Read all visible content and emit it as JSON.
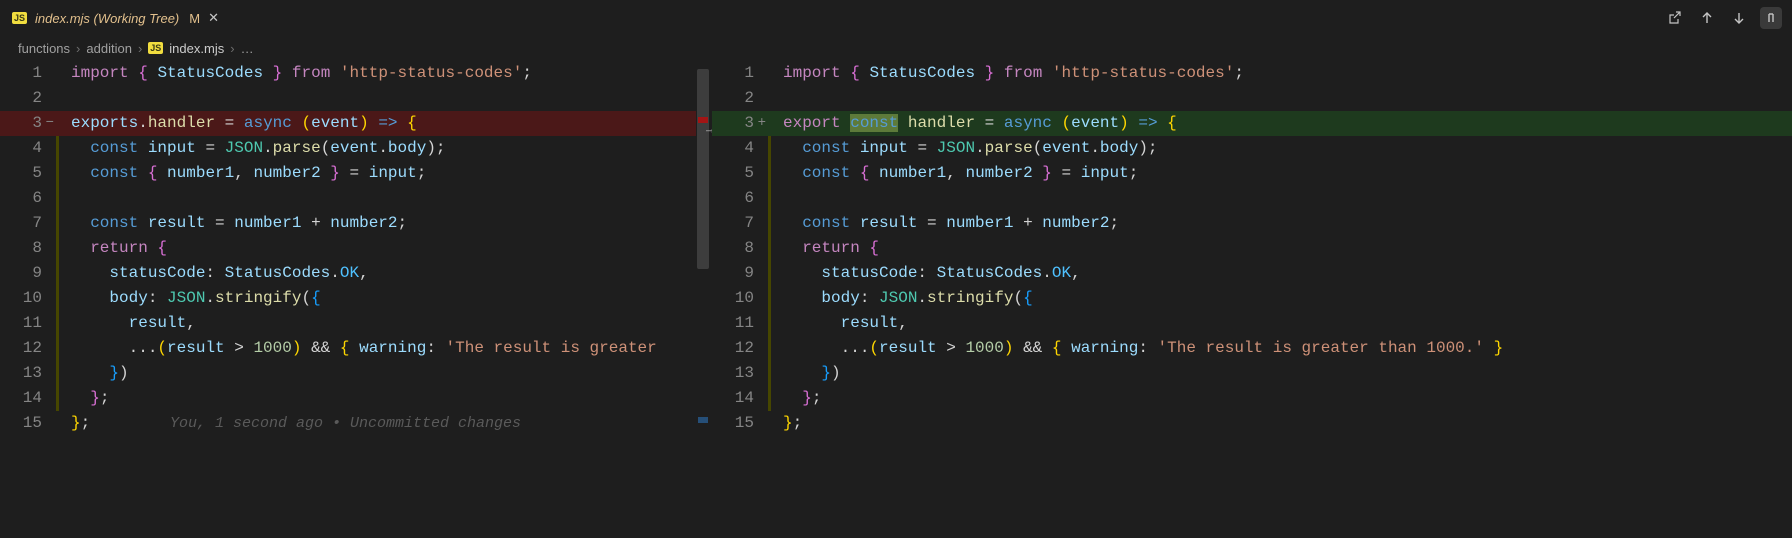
{
  "tab": {
    "icon_label": "JS",
    "title": "index.mjs (Working Tree)",
    "modified_badge": "M",
    "close_glyph": "✕"
  },
  "top_actions": {
    "names": [
      "open-file-icon",
      "prev-change-icon",
      "next-change-icon",
      "whitespace-icon"
    ]
  },
  "breadcrumbs": {
    "sep": "›",
    "parts": [
      "functions",
      "addition"
    ],
    "file_icon_label": "JS",
    "file": "index.mjs",
    "tail": "…"
  },
  "diff": {
    "arrow_glyph": "→"
  },
  "blame": {
    "text": "You, 1 second ago • Uncommitted changes"
  },
  "left": {
    "lines": [
      {
        "n": "1",
        "g": false,
        "m": "",
        "t": [
          [
            "kw",
            "import"
          ],
          [
            "pun",
            " "
          ],
          [
            "brc",
            "{"
          ],
          [
            "pun",
            " "
          ],
          [
            "var",
            "StatusCodes"
          ],
          [
            "pun",
            " "
          ],
          [
            "brc",
            "}"
          ],
          [
            "pun",
            " "
          ],
          [
            "kw",
            "from"
          ],
          [
            "pun",
            " "
          ],
          [
            "str",
            "'http-status-codes'"
          ],
          [
            "pun",
            ";"
          ]
        ]
      },
      {
        "n": "2",
        "g": false,
        "m": "",
        "t": []
      },
      {
        "n": "3",
        "g": false,
        "m": "−",
        "removed": true,
        "t": [
          [
            "var",
            "exports"
          ],
          [
            "pun",
            "."
          ],
          [
            "fn",
            "handler"
          ],
          [
            "pun",
            " = "
          ],
          [
            "kw2",
            "async"
          ],
          [
            "pun",
            " "
          ],
          [
            "brc3",
            "("
          ],
          [
            "var",
            "event"
          ],
          [
            "brc3",
            ")"
          ],
          [
            "pun",
            " "
          ],
          [
            "kw2",
            "=>"
          ],
          [
            "pun",
            " "
          ],
          [
            "brc3",
            "{"
          ]
        ]
      },
      {
        "n": "4",
        "g": true,
        "m": "",
        "t": [
          [
            "pun",
            "  "
          ],
          [
            "kw2",
            "const"
          ],
          [
            "pun",
            " "
          ],
          [
            "var",
            "input"
          ],
          [
            "pun",
            " = "
          ],
          [
            "cls",
            "JSON"
          ],
          [
            "pun",
            "."
          ],
          [
            "fn",
            "parse"
          ],
          [
            "pun",
            "("
          ],
          [
            "var",
            "event"
          ],
          [
            "pun",
            "."
          ],
          [
            "prop",
            "body"
          ],
          [
            "pun",
            ");"
          ]
        ]
      },
      {
        "n": "5",
        "g": true,
        "m": "",
        "t": [
          [
            "pun",
            "  "
          ],
          [
            "kw2",
            "const"
          ],
          [
            "pun",
            " "
          ],
          [
            "brc",
            "{"
          ],
          [
            "pun",
            " "
          ],
          [
            "var",
            "number1"
          ],
          [
            "pun",
            ", "
          ],
          [
            "var",
            "number2"
          ],
          [
            "pun",
            " "
          ],
          [
            "brc",
            "}"
          ],
          [
            "pun",
            " = "
          ],
          [
            "var",
            "input"
          ],
          [
            "pun",
            ";"
          ]
        ]
      },
      {
        "n": "6",
        "g": true,
        "m": "",
        "t": []
      },
      {
        "n": "7",
        "g": true,
        "m": "",
        "t": [
          [
            "pun",
            "  "
          ],
          [
            "kw2",
            "const"
          ],
          [
            "pun",
            " "
          ],
          [
            "var",
            "result"
          ],
          [
            "pun",
            " = "
          ],
          [
            "var",
            "number1"
          ],
          [
            "pun",
            " + "
          ],
          [
            "var",
            "number2"
          ],
          [
            "pun",
            ";"
          ]
        ]
      },
      {
        "n": "8",
        "g": true,
        "m": "",
        "t": [
          [
            "pun",
            "  "
          ],
          [
            "kw",
            "return"
          ],
          [
            "pun",
            " "
          ],
          [
            "brc",
            "{"
          ]
        ]
      },
      {
        "n": "9",
        "g": true,
        "m": "",
        "t": [
          [
            "pun",
            "    "
          ],
          [
            "prop",
            "statusCode"
          ],
          [
            "pun",
            ": "
          ],
          [
            "var",
            "StatusCodes"
          ],
          [
            "pun",
            "."
          ],
          [
            "cst",
            "OK"
          ],
          [
            "pun",
            ","
          ]
        ]
      },
      {
        "n": "10",
        "g": true,
        "m": "",
        "t": [
          [
            "pun",
            "    "
          ],
          [
            "prop",
            "body"
          ],
          [
            "pun",
            ": "
          ],
          [
            "cls",
            "JSON"
          ],
          [
            "pun",
            "."
          ],
          [
            "fn",
            "stringify"
          ],
          [
            "pun",
            "("
          ],
          [
            "brc2",
            "{"
          ]
        ]
      },
      {
        "n": "11",
        "g": true,
        "m": "",
        "t": [
          [
            "pun",
            "      "
          ],
          [
            "var",
            "result"
          ],
          [
            "pun",
            ","
          ]
        ]
      },
      {
        "n": "12",
        "g": true,
        "m": "",
        "t": [
          [
            "pun",
            "      ..."
          ],
          [
            "brc3",
            "("
          ],
          [
            "var",
            "result"
          ],
          [
            "pun",
            " > "
          ],
          [
            "num",
            "1000"
          ],
          [
            "brc3",
            ")"
          ],
          [
            "pun",
            " && "
          ],
          [
            "brc3",
            "{"
          ],
          [
            "pun",
            " "
          ],
          [
            "prop",
            "warning"
          ],
          [
            "pun",
            ": "
          ],
          [
            "str",
            "'The result is greater"
          ]
        ]
      },
      {
        "n": "13",
        "g": true,
        "m": "",
        "t": [
          [
            "pun",
            "    "
          ],
          [
            "brc2",
            "}"
          ],
          [
            "pun",
            ")"
          ]
        ]
      },
      {
        "n": "14",
        "g": true,
        "m": "",
        "t": [
          [
            "pun",
            "  "
          ],
          [
            "brc",
            "}"
          ],
          [
            "pun",
            ";"
          ]
        ]
      },
      {
        "n": "15",
        "g": false,
        "m": "",
        "blame": true,
        "t": [
          [
            "brc3",
            "}"
          ],
          [
            "pun",
            ";"
          ]
        ]
      }
    ]
  },
  "right": {
    "lines": [
      {
        "n": "1",
        "g": false,
        "m": "",
        "t": [
          [
            "kw",
            "import"
          ],
          [
            "pun",
            " "
          ],
          [
            "brc",
            "{"
          ],
          [
            "pun",
            " "
          ],
          [
            "var",
            "StatusCodes"
          ],
          [
            "pun",
            " "
          ],
          [
            "brc",
            "}"
          ],
          [
            "pun",
            " "
          ],
          [
            "kw",
            "from"
          ],
          [
            "pun",
            " "
          ],
          [
            "str",
            "'http-status-codes'"
          ],
          [
            "pun",
            ";"
          ]
        ]
      },
      {
        "n": "2",
        "g": false,
        "m": "",
        "t": []
      },
      {
        "n": "3",
        "g": false,
        "m": "+",
        "added": true,
        "t": [
          [
            "kw",
            "export"
          ],
          [
            "pun",
            " "
          ],
          [
            "kw2 h-ins",
            "const"
          ],
          [
            "pun",
            " "
          ],
          [
            "fn",
            "handler"
          ],
          [
            "pun",
            " = "
          ],
          [
            "kw2",
            "async"
          ],
          [
            "pun",
            " "
          ],
          [
            "brc3",
            "("
          ],
          [
            "var",
            "event"
          ],
          [
            "brc3",
            ")"
          ],
          [
            "pun",
            " "
          ],
          [
            "kw2",
            "=>"
          ],
          [
            "pun",
            " "
          ],
          [
            "brc3",
            "{"
          ]
        ]
      },
      {
        "n": "4",
        "g": true,
        "m": "",
        "t": [
          [
            "pun",
            "  "
          ],
          [
            "kw2",
            "const"
          ],
          [
            "pun",
            " "
          ],
          [
            "var",
            "input"
          ],
          [
            "pun",
            " = "
          ],
          [
            "cls",
            "JSON"
          ],
          [
            "pun",
            "."
          ],
          [
            "fn",
            "parse"
          ],
          [
            "pun",
            "("
          ],
          [
            "var",
            "event"
          ],
          [
            "pun",
            "."
          ],
          [
            "prop",
            "body"
          ],
          [
            "pun",
            ");"
          ]
        ]
      },
      {
        "n": "5",
        "g": true,
        "m": "",
        "t": [
          [
            "pun",
            "  "
          ],
          [
            "kw2",
            "const"
          ],
          [
            "pun",
            " "
          ],
          [
            "brc",
            "{"
          ],
          [
            "pun",
            " "
          ],
          [
            "var",
            "number1"
          ],
          [
            "pun",
            ", "
          ],
          [
            "var",
            "number2"
          ],
          [
            "pun",
            " "
          ],
          [
            "brc",
            "}"
          ],
          [
            "pun",
            " = "
          ],
          [
            "var",
            "input"
          ],
          [
            "pun",
            ";"
          ]
        ]
      },
      {
        "n": "6",
        "g": true,
        "m": "",
        "t": []
      },
      {
        "n": "7",
        "g": true,
        "m": "",
        "t": [
          [
            "pun",
            "  "
          ],
          [
            "kw2",
            "const"
          ],
          [
            "pun",
            " "
          ],
          [
            "var",
            "result"
          ],
          [
            "pun",
            " = "
          ],
          [
            "var",
            "number1"
          ],
          [
            "pun",
            " + "
          ],
          [
            "var",
            "number2"
          ],
          [
            "pun",
            ";"
          ]
        ]
      },
      {
        "n": "8",
        "g": true,
        "m": "",
        "t": [
          [
            "pun",
            "  "
          ],
          [
            "kw",
            "return"
          ],
          [
            "pun",
            " "
          ],
          [
            "brc",
            "{"
          ]
        ]
      },
      {
        "n": "9",
        "g": true,
        "m": "",
        "t": [
          [
            "pun",
            "    "
          ],
          [
            "prop",
            "statusCode"
          ],
          [
            "pun",
            ": "
          ],
          [
            "var",
            "StatusCodes"
          ],
          [
            "pun",
            "."
          ],
          [
            "cst",
            "OK"
          ],
          [
            "pun",
            ","
          ]
        ]
      },
      {
        "n": "10",
        "g": true,
        "m": "",
        "t": [
          [
            "pun",
            "    "
          ],
          [
            "prop",
            "body"
          ],
          [
            "pun",
            ": "
          ],
          [
            "cls",
            "JSON"
          ],
          [
            "pun",
            "."
          ],
          [
            "fn",
            "stringify"
          ],
          [
            "pun",
            "("
          ],
          [
            "brc2",
            "{"
          ]
        ]
      },
      {
        "n": "11",
        "g": true,
        "m": "",
        "t": [
          [
            "pun",
            "      "
          ],
          [
            "var",
            "result"
          ],
          [
            "pun",
            ","
          ]
        ]
      },
      {
        "n": "12",
        "g": true,
        "m": "",
        "t": [
          [
            "pun",
            "      ..."
          ],
          [
            "brc3",
            "("
          ],
          [
            "var",
            "result"
          ],
          [
            "pun",
            " > "
          ],
          [
            "num",
            "1000"
          ],
          [
            "brc3",
            ")"
          ],
          [
            "pun",
            " && "
          ],
          [
            "brc3",
            "{"
          ],
          [
            "pun",
            " "
          ],
          [
            "prop",
            "warning"
          ],
          [
            "pun",
            ": "
          ],
          [
            "str",
            "'The result is greater than 1000.'"
          ],
          [
            "pun",
            " "
          ],
          [
            "brc3",
            "}"
          ]
        ]
      },
      {
        "n": "13",
        "g": true,
        "m": "",
        "t": [
          [
            "pun",
            "    "
          ],
          [
            "brc2",
            "}"
          ],
          [
            "pun",
            ")"
          ]
        ]
      },
      {
        "n": "14",
        "g": true,
        "m": "",
        "t": [
          [
            "pun",
            "  "
          ],
          [
            "brc",
            "}"
          ],
          [
            "pun",
            ";"
          ]
        ]
      },
      {
        "n": "15",
        "g": false,
        "m": "",
        "t": [
          [
            "brc3",
            "}"
          ],
          [
            "pun",
            ";"
          ]
        ]
      }
    ]
  }
}
